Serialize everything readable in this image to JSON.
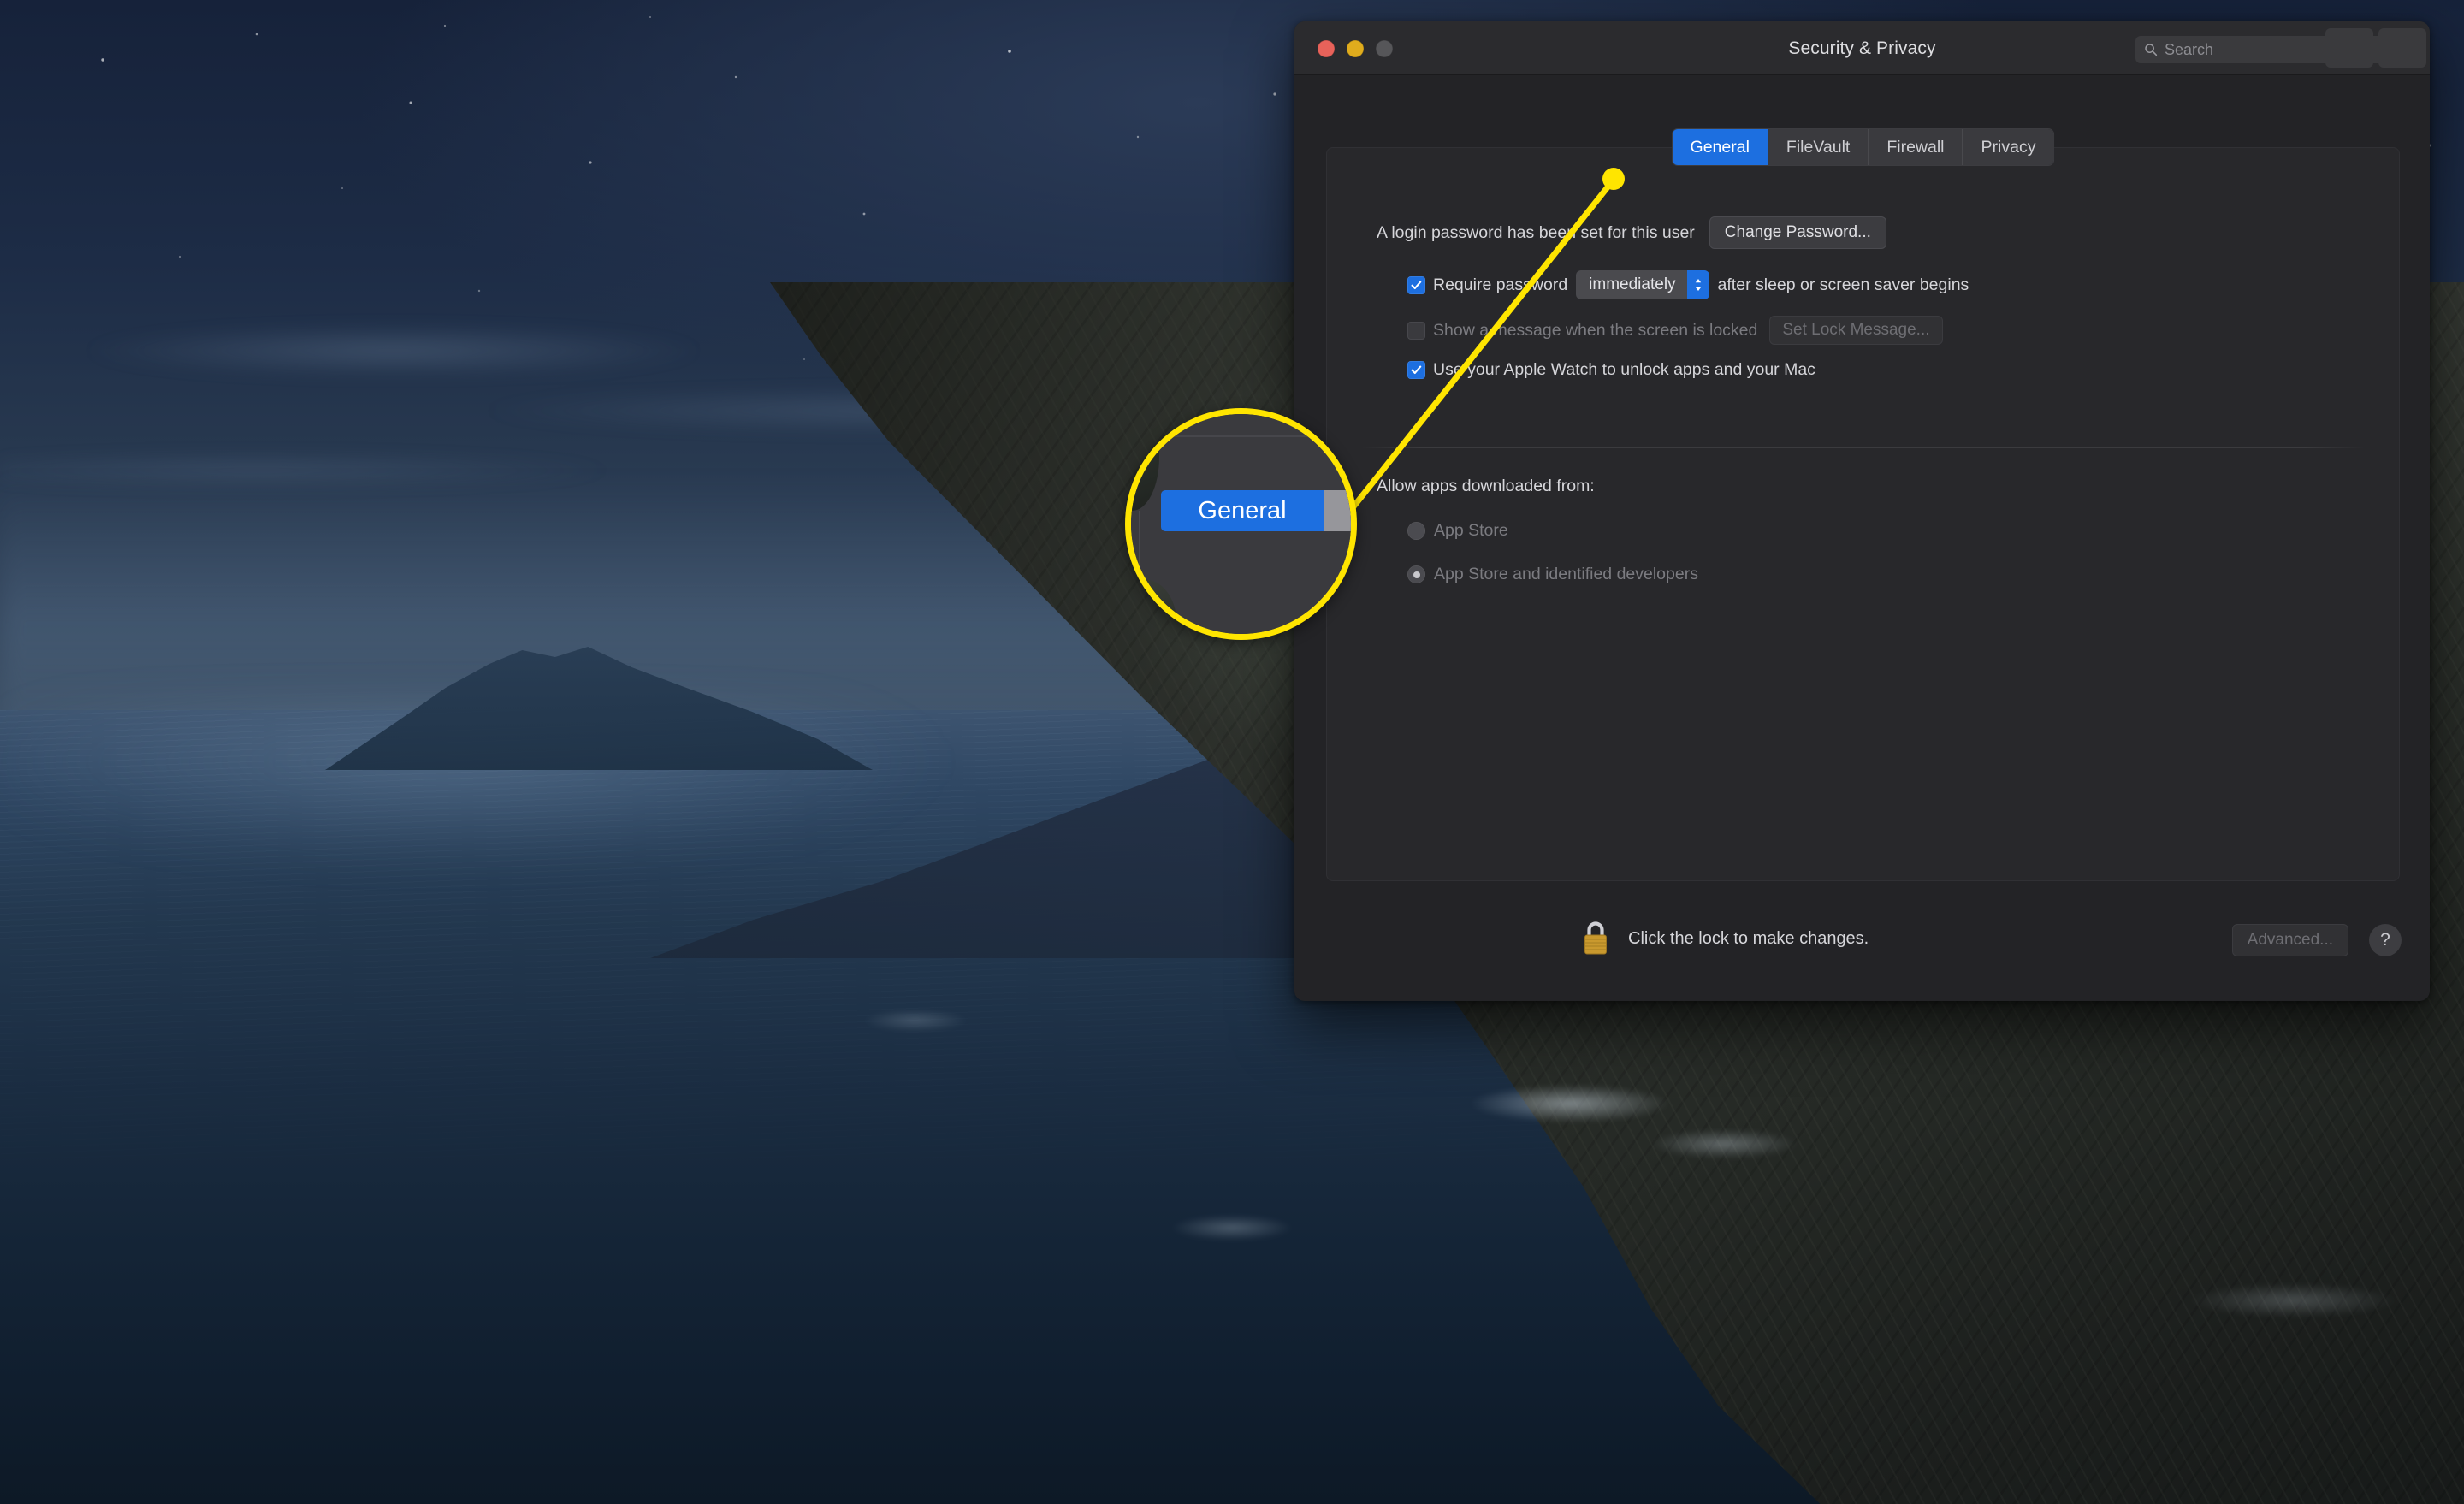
{
  "window": {
    "title": "Security & Privacy",
    "traffic_lights": [
      "close-red",
      "minimize-yellow",
      "zoom-disabled-gray"
    ],
    "nav": {
      "back_icon": "chevron-left-icon",
      "forward_icon": "chevron-right-icon",
      "grid_icon": "grid-view-icon"
    },
    "search": {
      "placeholder": "Search",
      "icon": "search-icon",
      "value": ""
    }
  },
  "tabs": [
    {
      "label": "General",
      "active": true
    },
    {
      "label": "FileVault",
      "active": false
    },
    {
      "label": "Firewall",
      "active": false
    },
    {
      "label": "Privacy",
      "active": false
    }
  ],
  "general": {
    "login_password_text": "A login password has been set for this user",
    "change_password_button": "Change Password...",
    "require_password": {
      "checked": true,
      "label_before": "Require password",
      "popup_value": "immediately",
      "label_after": "after sleep or screen saver begins"
    },
    "show_message": {
      "checked": false,
      "enabled": false,
      "label": "Show a message when the screen is locked",
      "button": "Set Lock Message..."
    },
    "apple_watch": {
      "checked": true,
      "label": "Use your Apple Watch to unlock apps and your Mac"
    },
    "allow_apps": {
      "heading": "Allow apps downloaded from:",
      "enabled": false,
      "options": [
        {
          "label": "App Store",
          "selected": false
        },
        {
          "label": "App Store and identified developers",
          "selected": true
        }
      ]
    }
  },
  "bottom_bar": {
    "lock_icon": "padlock-closed-icon",
    "lock_text": "Click the lock to make changes.",
    "advanced_button": "Advanced...",
    "advanced_enabled": false,
    "help_button": "?"
  },
  "callout": {
    "magnified_label": "General",
    "ring_color": "#ffe500",
    "line_color": "#ffe500",
    "dot_color": "#ffe500"
  },
  "colors": {
    "accent_blue": "#1d6fe0",
    "window_bg": "#232326",
    "panel_bg": "#28282b",
    "titlebar_bg": "#2b2b2e",
    "text_primary": "#d6d6da",
    "text_dim": "#7b7b80",
    "callout_yellow": "#ffe500"
  },
  "desktop": {
    "wallpaper": "catalina-coast-night"
  }
}
